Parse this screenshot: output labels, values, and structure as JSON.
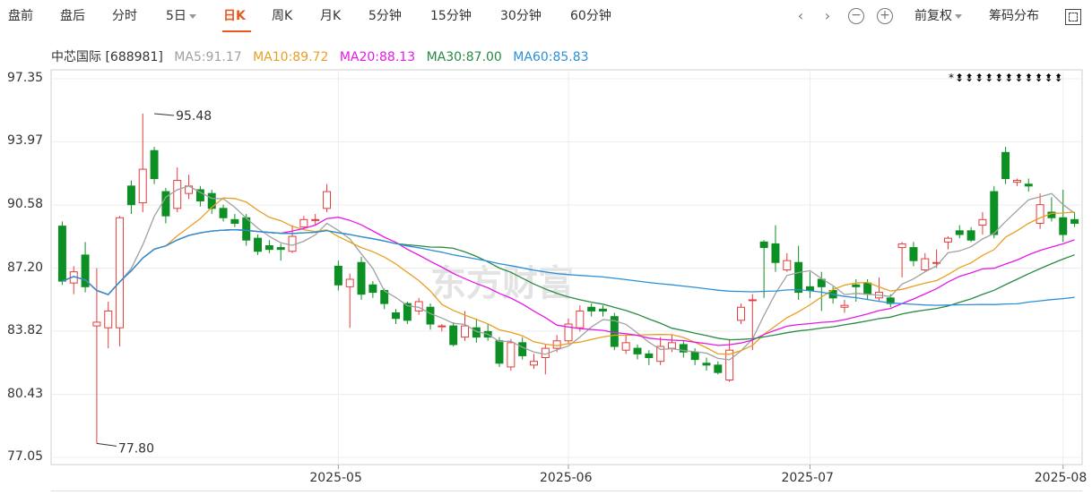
{
  "toolbar": {
    "tabs": [
      {
        "label": "盘前"
      },
      {
        "label": "盘后"
      },
      {
        "label": "分时"
      },
      {
        "label": "5日"
      },
      {
        "label": "日K"
      },
      {
        "label": "周K"
      },
      {
        "label": "月K"
      },
      {
        "label": "5分钟"
      },
      {
        "label": "15分钟"
      },
      {
        "label": "30分钟"
      },
      {
        "label": "60分钟"
      }
    ],
    "active_tab": "日K",
    "adjust_label": "前复权",
    "chip_label": "筹码分布"
  },
  "legend": {
    "stock": "中芯国际 [688981]",
    "ma5": "MA5:91.17",
    "ma10": "MA10:89.72",
    "ma20": "MA20:88.13",
    "ma30": "MA30:87.00",
    "ma60": "MA60:85.83"
  },
  "colors": {
    "up": "#e83a3a",
    "down": "#0c8f23",
    "ma5": "#a0a0a0",
    "ma10": "#e8a020",
    "ma20": "#e619e6",
    "ma30": "#2a8a45",
    "ma60": "#2c8fd8",
    "accent": "#e8581f"
  },
  "watermark": "东方财富",
  "markers": "*⬍⬍⬍⬍⬍⬍⬍⬍⬍⬍⬍",
  "chart_data": {
    "type": "candlestick",
    "ylim": [
      77.05,
      97.35
    ],
    "y_ticks": [
      "97.35",
      "93.97",
      "90.58",
      "87.20",
      "83.82",
      "80.43",
      "77.05"
    ],
    "x_ticks": [
      {
        "label": "2025-05",
        "i": 24
      },
      {
        "label": "2025-06",
        "i": 44
      },
      {
        "label": "2025-07",
        "i": 65
      },
      {
        "label": "2025-08",
        "i": 87
      }
    ],
    "annotations": [
      {
        "text": "95.48",
        "i": 8,
        "price": 95.48
      },
      {
        "text": "77.80",
        "i": 3,
        "price": 77.8
      }
    ],
    "candles": [
      [
        89.45,
        86.5,
        86.3,
        89.7
      ],
      [
        86.4,
        87.0,
        85.8,
        87.3
      ],
      [
        87.9,
        86.2,
        85.9,
        88.6
      ],
      [
        84.1,
        84.3,
        77.8,
        87.2
      ],
      [
        84.0,
        84.9,
        82.9,
        85.4
      ],
      [
        84.0,
        89.9,
        83.0,
        90.0
      ],
      [
        91.6,
        90.6,
        90.1,
        91.9
      ],
      [
        90.7,
        92.5,
        90.2,
        95.48
      ],
      [
        93.5,
        92.0,
        91.7,
        93.7
      ],
      [
        91.3,
        90.0,
        89.6,
        91.5
      ],
      [
        90.4,
        91.9,
        90.2,
        92.6
      ],
      [
        91.2,
        91.6,
        90.9,
        92.2
      ],
      [
        91.4,
        90.8,
        90.5,
        91.6
      ],
      [
        91.2,
        90.4,
        90.1,
        91.4
      ],
      [
        90.4,
        89.9,
        89.7,
        90.6
      ],
      [
        89.8,
        89.6,
        89.4,
        90.1
      ],
      [
        89.9,
        88.7,
        88.4,
        90.1
      ],
      [
        88.8,
        88.1,
        87.9,
        89.0
      ],
      [
        88.4,
        88.2,
        88.0,
        88.7
      ],
      [
        88.3,
        88.2,
        87.6,
        88.5
      ],
      [
        88.1,
        88.9,
        88.0,
        89.5
      ],
      [
        89.4,
        89.8,
        89.3,
        90.0
      ],
      [
        89.8,
        89.8,
        89.5,
        90.1
      ],
      [
        90.4,
        91.3,
        90.2,
        91.7
      ],
      [
        87.3,
        86.3,
        86.0,
        87.6
      ],
      [
        86.2,
        86.6,
        84.0,
        86.9
      ],
      [
        87.5,
        85.8,
        85.5,
        87.8
      ],
      [
        86.3,
        85.9,
        85.6,
        86.5
      ],
      [
        86.0,
        85.3,
        85.0,
        86.1
      ],
      [
        84.8,
        84.5,
        84.2,
        85.0
      ],
      [
        85.3,
        84.4,
        84.2,
        85.4
      ],
      [
        84.9,
        85.4,
        84.7,
        85.6
      ],
      [
        85.1,
        84.2,
        83.9,
        85.3
      ],
      [
        84.1,
        84.1,
        83.8,
        84.2
      ],
      [
        84.1,
        83.1,
        83.0,
        84.3
      ],
      [
        83.5,
        84.1,
        83.3,
        84.9
      ],
      [
        84.0,
        83.5,
        83.2,
        84.5
      ],
      [
        83.8,
        83.5,
        83.3,
        84.2
      ],
      [
        83.3,
        82.1,
        81.9,
        83.5
      ],
      [
        81.9,
        83.2,
        81.7,
        83.4
      ],
      [
        83.2,
        82.5,
        82.3,
        83.5
      ],
      [
        82.0,
        82.2,
        81.8,
        82.6
      ],
      [
        82.4,
        82.9,
        81.5,
        83.1
      ],
      [
        82.9,
        83.3,
        82.7,
        83.6
      ],
      [
        83.3,
        84.2,
        83.1,
        84.5
      ],
      [
        84.0,
        84.9,
        83.8,
        85.2
      ],
      [
        85.1,
        84.9,
        84.6,
        85.3
      ],
      [
        85.0,
        84.9,
        84.6,
        85.2
      ],
      [
        84.6,
        83.0,
        82.8,
        84.8
      ],
      [
        82.8,
        83.2,
        82.6,
        83.6
      ],
      [
        82.9,
        82.6,
        82.3,
        83.1
      ],
      [
        82.6,
        82.4,
        82.0,
        82.8
      ],
      [
        82.2,
        83.0,
        82.0,
        83.5
      ],
      [
        82.9,
        83.2,
        82.7,
        83.6
      ],
      [
        83.1,
        82.7,
        82.4,
        83.3
      ],
      [
        82.7,
        82.3,
        82.0,
        82.9
      ],
      [
        82.1,
        82.0,
        81.7,
        82.4
      ],
      [
        82.0,
        81.6,
        81.5,
        82.2
      ],
      [
        81.2,
        82.8,
        81.1,
        83.4
      ],
      [
        84.4,
        85.1,
        84.2,
        85.3
      ],
      [
        85.5,
        85.5,
        82.8,
        85.8
      ],
      [
        88.6,
        88.3,
        85.6,
        88.7
      ],
      [
        88.5,
        87.5,
        87.0,
        89.5
      ],
      [
        87.1,
        87.6,
        87.0,
        88.0
      ],
      [
        87.5,
        85.9,
        85.5,
        88.4
      ],
      [
        86.2,
        86.0,
        85.6,
        87.0
      ],
      [
        86.6,
        86.2,
        84.9,
        87.0
      ],
      [
        86.0,
        85.6,
        85.3,
        86.2
      ],
      [
        85.1,
        85.2,
        84.8,
        85.5
      ],
      [
        86.3,
        86.2,
        85.4,
        86.6
      ],
      [
        86.4,
        85.8,
        85.5,
        86.6
      ],
      [
        85.6,
        85.9,
        85.4,
        86.7
      ],
      [
        85.6,
        85.3,
        85.1,
        85.8
      ],
      [
        88.3,
        88.5,
        86.7,
        88.6
      ],
      [
        88.3,
        87.6,
        87.3,
        88.6
      ],
      [
        87.1,
        87.7,
        87.0,
        88.0
      ],
      [
        87.5,
        87.5,
        87.2,
        88.2
      ],
      [
        88.6,
        88.8,
        88.2,
        88.9
      ],
      [
        89.2,
        89.0,
        88.8,
        89.5
      ],
      [
        89.2,
        88.7,
        88.6,
        89.4
      ],
      [
        89.5,
        89.8,
        89.0,
        90.2
      ],
      [
        91.3,
        89.0,
        88.8,
        91.6
      ],
      [
        93.4,
        92.0,
        91.7,
        93.7
      ],
      [
        91.8,
        91.9,
        91.6,
        92.0
      ],
      [
        91.7,
        91.6,
        91.3,
        92.0
      ],
      [
        89.6,
        90.6,
        89.3,
        91.2
      ],
      [
        90.2,
        89.9,
        89.7,
        91.0
      ],
      [
        89.9,
        89.0,
        88.6,
        91.4
      ],
      [
        89.8,
        89.6,
        89.4,
        90.2
      ]
    ]
  }
}
